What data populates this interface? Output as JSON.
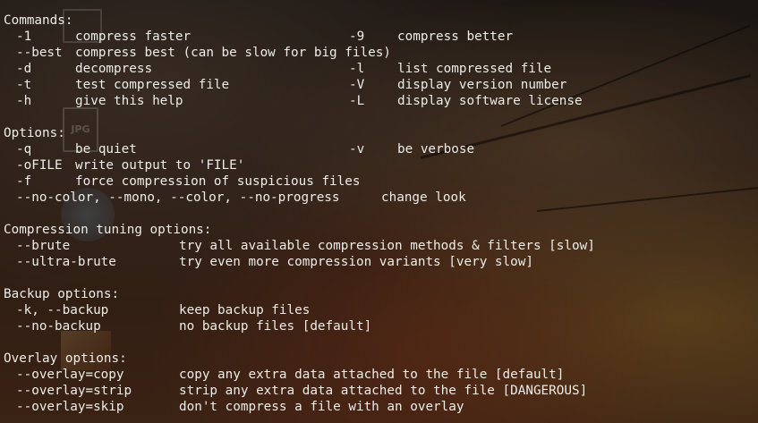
{
  "terminal": {
    "commands_header": "Commands:",
    "cmd_rows": [
      {
        "opt": "-1",
        "desc": "compress faster",
        "opt2": "-9",
        "desc2": "compress better"
      },
      {
        "opt": "--best",
        "desc": "compress best (can be slow for big files)",
        "opt2": "",
        "desc2": ""
      },
      {
        "opt": "-d",
        "desc": "decompress",
        "opt2": "-l",
        "desc2": "list compressed file"
      },
      {
        "opt": "-t",
        "desc": "test compressed file",
        "opt2": "-V",
        "desc2": "display version number"
      },
      {
        "opt": "-h",
        "desc": "give this help",
        "opt2": "-L",
        "desc2": "display software license"
      }
    ],
    "options_header": "Options:",
    "opt_rows": [
      {
        "opt": "-q",
        "desc": "be quiet",
        "opt2": "-v",
        "desc2": "be verbose"
      },
      {
        "opt": "-oFILE",
        "desc": "write output to 'FILE'",
        "opt2": "",
        "desc2": ""
      },
      {
        "opt": "-f",
        "desc": "force compression of suspicious files",
        "opt2": "",
        "desc2": ""
      },
      {
        "opt": "--no-color, --mono, --color, --no-progress",
        "desc": "change look",
        "opt2": "",
        "desc2": ""
      }
    ],
    "tuning_header": "Compression tuning options:",
    "tuning_rows": [
      {
        "opt": "--brute",
        "desc": "try all available compression methods & filters [slow]"
      },
      {
        "opt": "--ultra-brute",
        "desc": "try even more compression variants [very slow]"
      }
    ],
    "backup_header": "Backup options:",
    "backup_rows": [
      {
        "opt": "-k, --backup",
        "desc": "keep backup files"
      },
      {
        "opt": "--no-backup",
        "desc": "no backup files [default]"
      }
    ],
    "overlay_header": "Overlay options:",
    "overlay_rows": [
      {
        "opt": "--overlay=copy",
        "desc": "copy any extra data attached to the file [default]"
      },
      {
        "opt": "--overlay=strip",
        "desc": "strip any extra data attached to the file [DANGEROUS]"
      },
      {
        "opt": "--overlay=skip",
        "desc": "don't compress a file with an overlay"
      }
    ]
  },
  "desktop": {
    "icon_jpg_label": "JPG"
  },
  "colors": {
    "text": "#eeede8",
    "background": "#2a1c14"
  }
}
